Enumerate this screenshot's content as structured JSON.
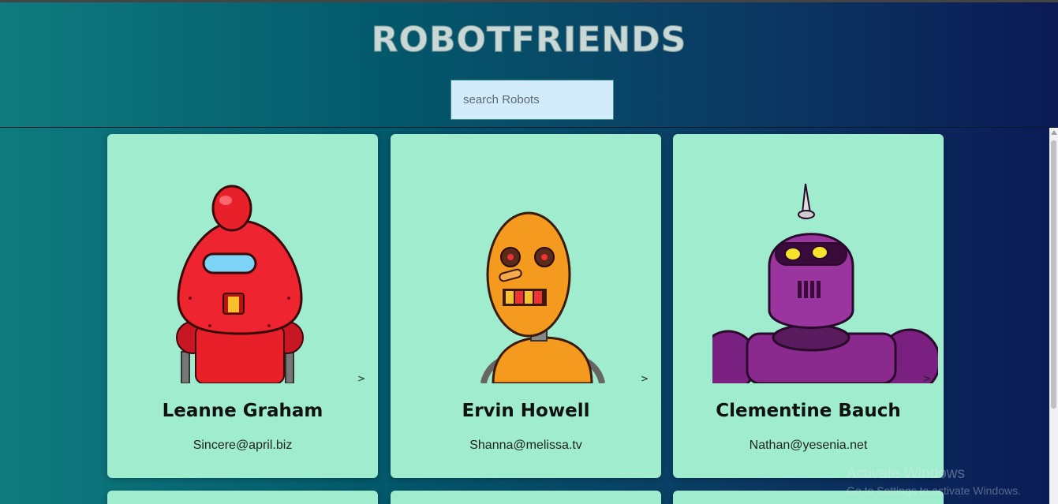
{
  "app": {
    "title": "ROBOTFRIENDS"
  },
  "search": {
    "placeholder": "search Robots",
    "value": ""
  },
  "cards": [
    {
      "name": "Leanne Graham",
      "email": "Sincere@april.biz",
      "robot_icon": "red-robot",
      "color": "#e8202a"
    },
    {
      "name": "Ervin Howell",
      "email": "Shanna@melissa.tv",
      "robot_icon": "orange-robot",
      "color": "#f39a1f"
    },
    {
      "name": "Clementine Bauch",
      "email": "Nathan@yesenia.net",
      "robot_icon": "purple-robot",
      "color": "#8b2a8e"
    }
  ],
  "card_nav": {
    "next_label": ">"
  },
  "watermark": {
    "title": "Activate Windows",
    "subtitle": "Go to Settings to activate Windows."
  },
  "colors": {
    "card_bg": "#9feccf",
    "search_bg": "#d3ecfb",
    "header_left": "#0f7b7e",
    "header_right": "#0b1a55"
  }
}
